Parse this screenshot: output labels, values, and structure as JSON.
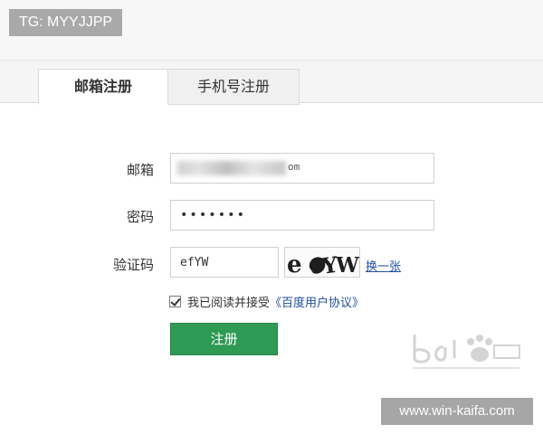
{
  "watermark": {
    "tg_label": "TG: MYYJJPP",
    "site_label": "www.win-kaifa.com"
  },
  "tabs": [
    {
      "label": "邮箱注册",
      "active": true
    },
    {
      "label": "手机号注册",
      "active": false
    }
  ],
  "form": {
    "email": {
      "label": "邮箱",
      "value_suffix": "om"
    },
    "password": {
      "label": "密码",
      "value": "•••••••"
    },
    "captcha": {
      "label": "验证码",
      "value": "efYW",
      "image_text": "efYW",
      "refresh_label": "换一张"
    },
    "agreement": {
      "checked": true,
      "prefix": "我已阅读并接受",
      "link": "《百度用户协议》"
    },
    "submit_label": "注册"
  },
  "colors": {
    "accent_green": "#2e9a53",
    "link_blue": "#1f4e9e"
  }
}
